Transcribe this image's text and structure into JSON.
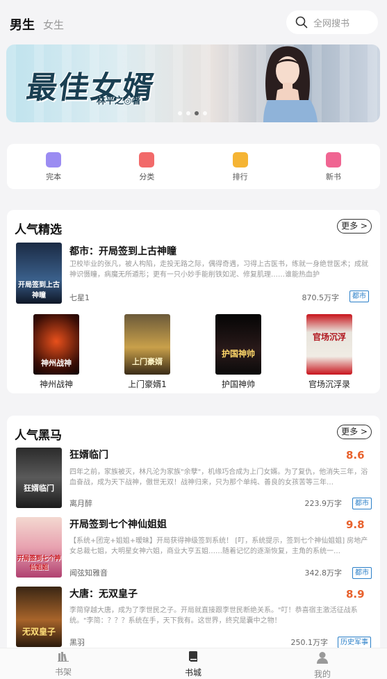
{
  "header": {
    "tab_male": "男生",
    "tab_female": "女生",
    "search_placeholder": "全网搜书"
  },
  "banner": {
    "title": "最佳女婿",
    "author": "林平之◎著",
    "active_dot": 3,
    "dot_count": 4
  },
  "categories": [
    {
      "label": "完本",
      "icon": "book-icon",
      "color": "#9b8cf2"
    },
    {
      "label": "分类",
      "icon": "category-icon",
      "color": "#f26a6a"
    },
    {
      "label": "排行",
      "icon": "ranking-icon",
      "color": "#f5b434"
    },
    {
      "label": "新书",
      "icon": "star-icon",
      "color": "#f06592"
    }
  ],
  "popular": {
    "title": "人气精选",
    "more": "更多 >",
    "featured": {
      "title": "都市：开局签到上古神瞳",
      "desc": "卫校毕业的张凡，被人构陷，走投无路之际，偶得奇遇，习得上古医书，练就一身绝世医术；成就神识慑瞳，病魔无所遁形；更有一只小妙手能削铁如泥、修复肌理……谁能热血护",
      "author": "七星1",
      "words": "870.5万字",
      "tag": "都市",
      "cover_text": "开局签到上古神瞳"
    },
    "grid": [
      {
        "name": "神州战神",
        "cover_text": "神州战神"
      },
      {
        "name": "上门豪婿1",
        "cover_text": "上门豪婿"
      },
      {
        "name": "护国神帅",
        "cover_text": "护国神帅"
      },
      {
        "name": "官场沉浮录",
        "cover_text": "官场沉浮"
      }
    ]
  },
  "darkhorse": {
    "title": "人气黑马",
    "more": "更多 >",
    "books": [
      {
        "title": "狂婿临门",
        "score": "8.6",
        "desc": "四年之前，家族被灭，林凡沦为家族\"余孽\"，机缘巧合成为上门女婿。为了复仇，他消失三年，浴血奋战，成为天下战神，傲世无双！战神归来，只为那个单纯、善良的女孩苦等三年…",
        "author": "离月醉",
        "words": "223.9万字",
        "tag": "都市",
        "cover_text": "狂婿临门"
      },
      {
        "title": "开局签到七个神仙姐姐",
        "score": "9.8",
        "desc": "【系统+团宠+姐姐+暧昧】开局获得神级签到系统！ [叮，系统提示，签到七个神仙姐姐] 房地产女总裁七姐，大明星女神六姐，商业大亨五姐……随着记忆的逐渐恢复，主角的系统一…",
        "author": "闻弦知雅音",
        "words": "342.8万字",
        "tag": "都市",
        "cover_text": "开局签到七个神仙姐姐"
      },
      {
        "title": "大唐：无双皇子",
        "score": "8.9",
        "desc": "李简穿越大唐，成为了李世民之子。开局就直接跟李世民断绝关系。\"叮！恭喜宿主激活征战系统。\"李简：？？？系统在手，天下我有。这世界，终究是囊中之物！",
        "author": "黑羽",
        "words": "250.1万字",
        "tag": "历史军事",
        "cover_text": "无双皇子"
      }
    ]
  },
  "nav": [
    {
      "label": "书架",
      "icon": "bookshelf-icon",
      "active": false
    },
    {
      "label": "书城",
      "icon": "bookstore-icon",
      "active": true
    },
    {
      "label": "我的",
      "icon": "user-icon",
      "active": false
    }
  ]
}
